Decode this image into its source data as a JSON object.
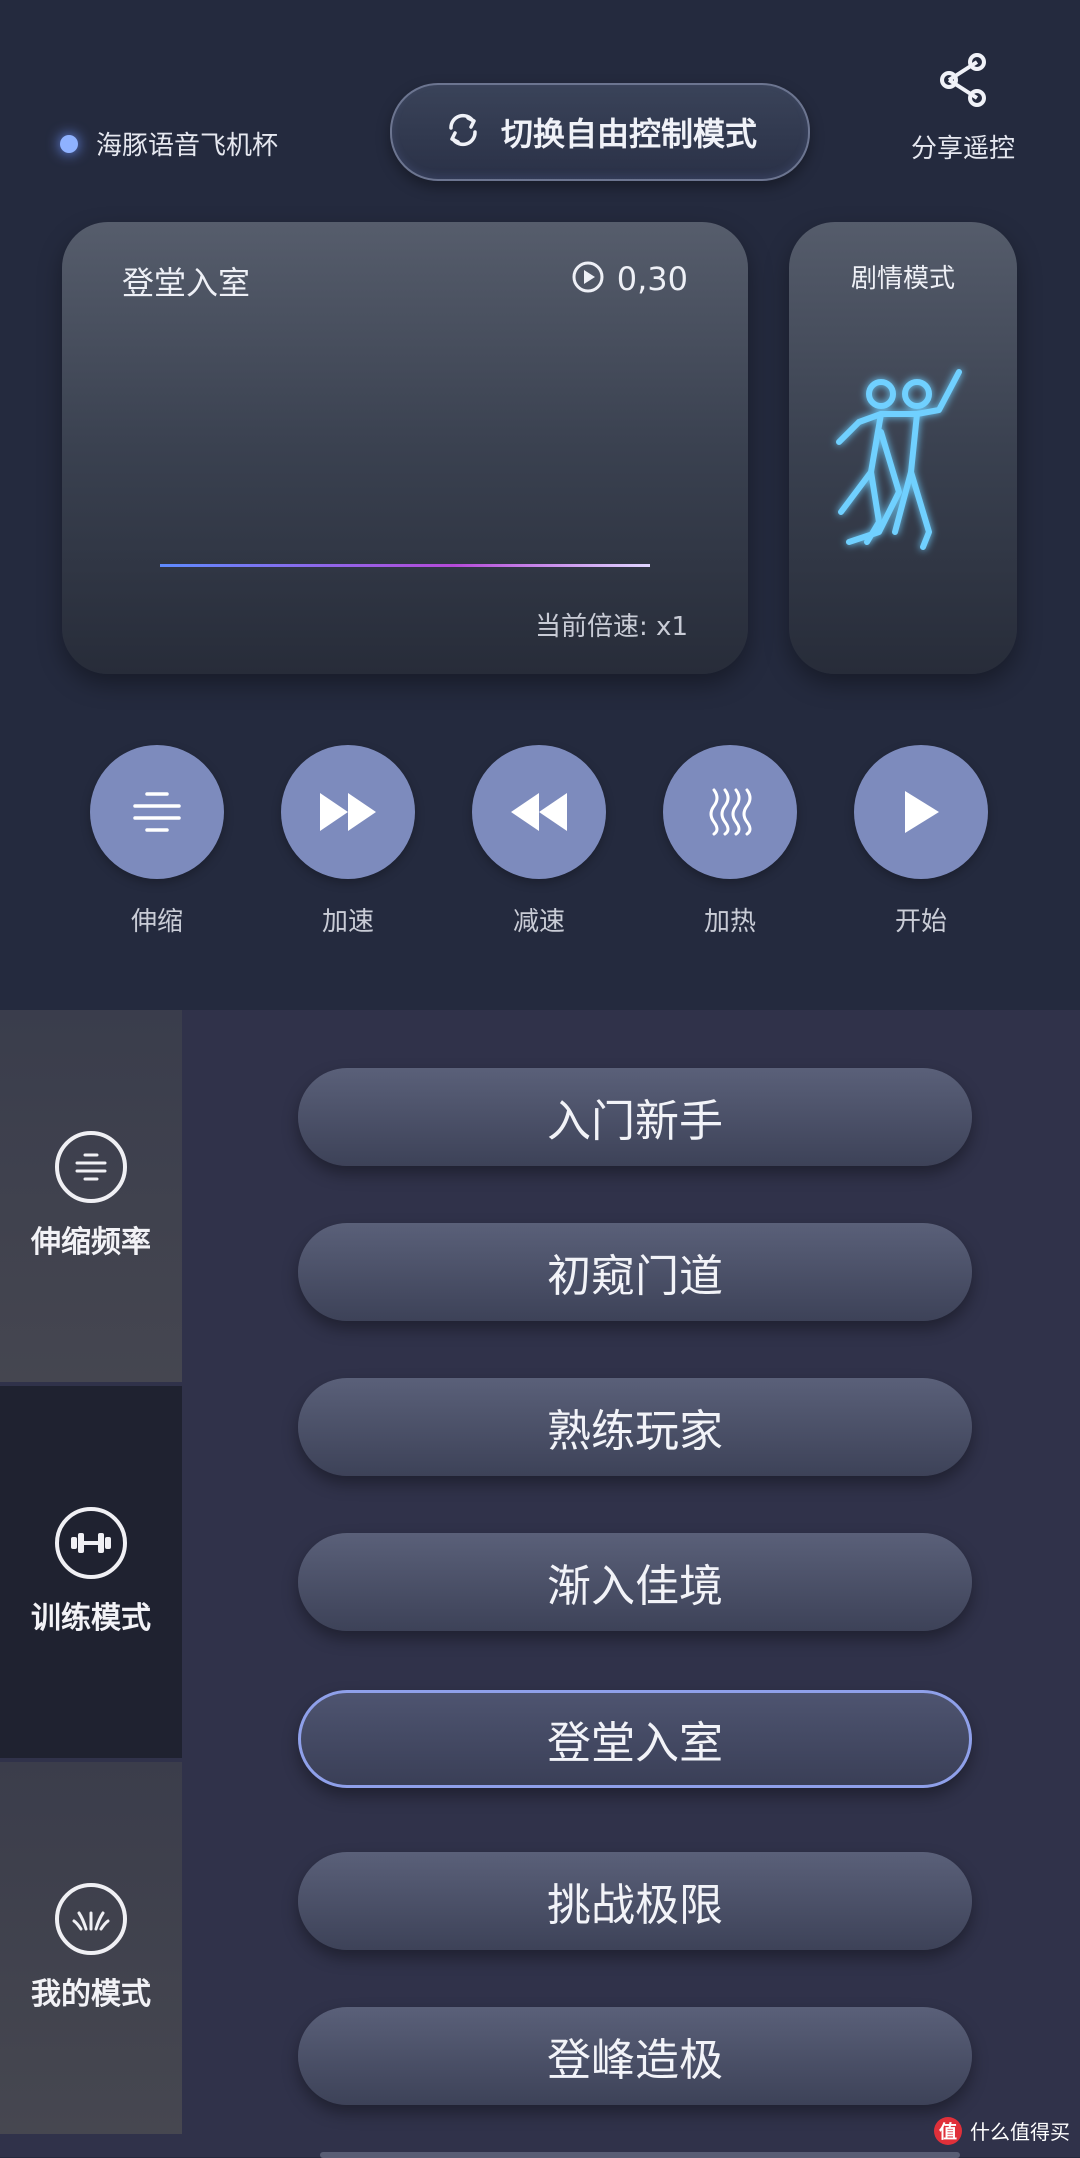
{
  "header": {
    "device_name": "海豚语音飞机杯",
    "switch_label": "切换自由控制模式",
    "share_label": "分享遥控"
  },
  "scene": {
    "title": "登堂入室",
    "time": "0,30",
    "speed": "当前倍速: x1"
  },
  "story": {
    "title": "剧情模式"
  },
  "controls": [
    {
      "label": "伸缩",
      "icon": "telescopic-icon"
    },
    {
      "label": "加速",
      "icon": "fast-forward-icon"
    },
    {
      "label": "减速",
      "icon": "rewind-icon"
    },
    {
      "label": "加热",
      "icon": "heat-icon"
    },
    {
      "label": "开始",
      "icon": "play-icon"
    }
  ],
  "sidebar": [
    {
      "label": "伸缩频率",
      "icon": "frequency-icon"
    },
    {
      "label": "训练模式",
      "icon": "dumbbell-icon"
    },
    {
      "label": "我的模式",
      "icon": "my-mode-icon"
    }
  ],
  "modes": [
    "入门新手",
    "初窥门道",
    "熟练玩家",
    "渐入佳境",
    "登堂入室",
    "挑战极限",
    "登峰造极"
  ],
  "active_mode": "登堂入室",
  "watermark": {
    "badge": "值",
    "text": "什么值得买"
  },
  "colors": {
    "background": "#242a3e",
    "accent": "#7d8bbd",
    "active_border": "#8fa0ea",
    "neon": "#6fd0ff"
  }
}
